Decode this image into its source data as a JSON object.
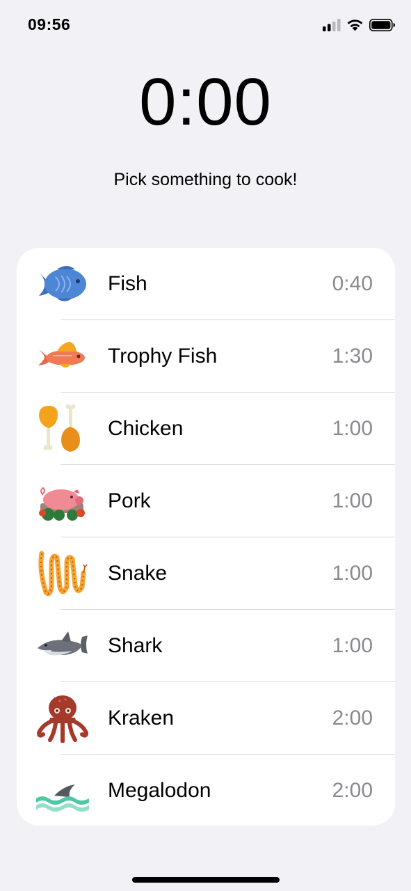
{
  "status_bar": {
    "time": "09:56",
    "icons": [
      "signal-icon",
      "wifi-icon",
      "battery-icon"
    ]
  },
  "timer": {
    "display": "0:00"
  },
  "subtitle": "Pick something to cook!",
  "menu": {
    "items": [
      {
        "label": "Fish",
        "time": "0:40",
        "icon": "fish-icon"
      },
      {
        "label": "Trophy Fish",
        "time": "1:30",
        "icon": "trophy-fish-icon"
      },
      {
        "label": "Chicken",
        "time": "1:00",
        "icon": "chicken-icon"
      },
      {
        "label": "Pork",
        "time": "1:00",
        "icon": "pig-icon"
      },
      {
        "label": "Snake",
        "time": "1:00",
        "icon": "snake-icon"
      },
      {
        "label": "Shark",
        "time": "1:00",
        "icon": "shark-icon"
      },
      {
        "label": "Kraken",
        "time": "2:00",
        "icon": "octopus-icon"
      },
      {
        "label": "Megalodon",
        "time": "2:00",
        "icon": "shark-fin-icon"
      }
    ]
  }
}
